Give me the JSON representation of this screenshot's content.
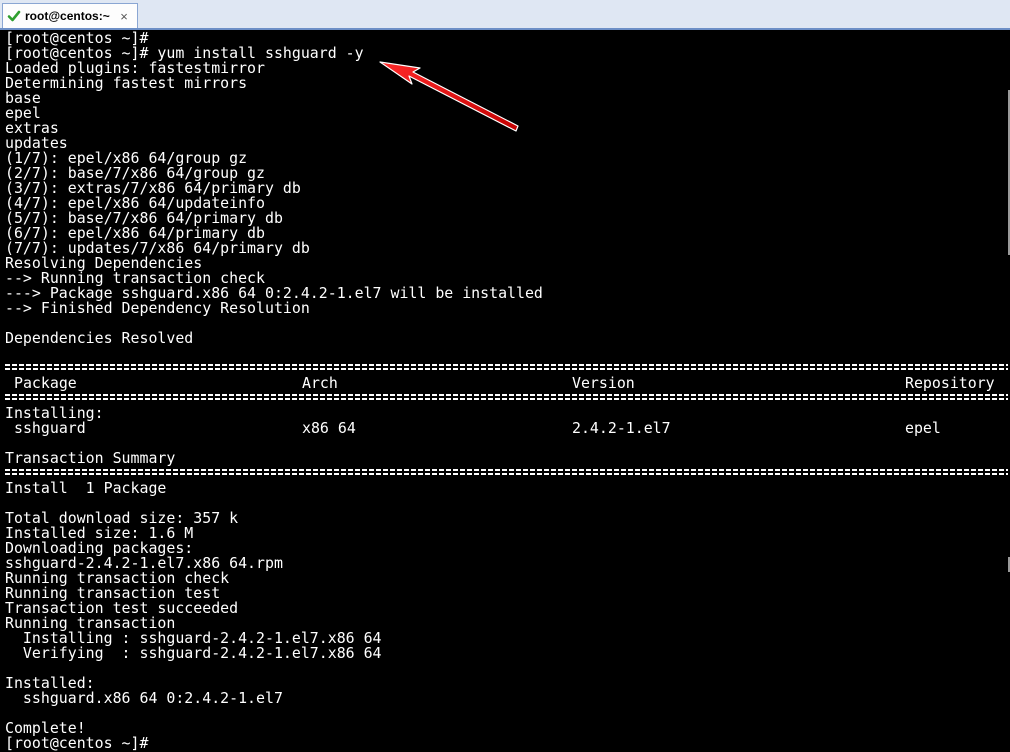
{
  "window": {
    "tab_title": "root@centos:~",
    "tab_close": "×",
    "tab_status_icon": "check-icon",
    "accent": "#2e9f2e"
  },
  "terminal": {
    "prompt_empty": "[root@centos ~]#",
    "command_line": "[root@centos ~]# yum install sshguard -y",
    "output_top": [
      "Loaded plugins: fastestmirror",
      "Determining fastest mirrors",
      "base",
      "epel",
      "extras",
      "updates",
      "(1/7): epel/x86_64/group_gz",
      "(2/7): base/7/x86_64/group_gz",
      "(3/7): extras/7/x86_64/primary_db",
      "(4/7): epel/x86_64/updateinfo",
      "(5/7): base/7/x86_64/primary_db",
      "(6/7): epel/x86_64/primary_db",
      "(7/7): updates/7/x86_64/primary_db",
      "Resolving Dependencies",
      "--> Running transaction check",
      "---> Package sshguard.x86_64 0:2.4.2-1.el7 will be installed",
      "--> Finished Dependency Resolution",
      "",
      "Dependencies Resolved"
    ],
    "table": {
      "headers": [
        "Package",
        "Arch",
        "Version",
        "Repository"
      ],
      "section": "Installing:",
      "row": [
        "sshguard",
        "x86_64",
        "2.4.2-1.el7",
        "epel"
      ]
    },
    "summary_title": "Transaction Summary",
    "summary_line": "Install  1 Package",
    "output_bottom": [
      "Total download size: 357 k",
      "Installed size: 1.6 M",
      "Downloading packages:",
      "sshguard-2.4.2-1.el7.x86_64.rpm",
      "Running transaction check",
      "Running transaction test",
      "Transaction test succeeded",
      "Running transaction",
      "  Installing : sshguard-2.4.2-1.el7.x86_64",
      "  Verifying  : sshguard-2.4.2-1.el7.x86_64",
      "",
      "Installed:",
      "  sshguard.x86_64 0:2.4.2-1.el7",
      "",
      "Complete!"
    ],
    "prompt_final": "[root@centos ~]#",
    "annotation_color": "#e8141b"
  }
}
